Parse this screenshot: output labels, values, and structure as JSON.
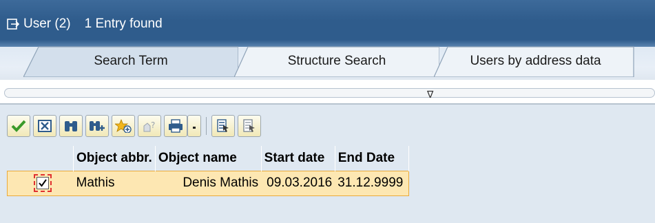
{
  "title": {
    "icon": "exit-arrow-icon",
    "object_label": "User (2)",
    "entry_count": "1 Entry found"
  },
  "tabs": [
    {
      "label": "Search Term",
      "active": true
    },
    {
      "label": "Structure Search",
      "active": false
    },
    {
      "label": "Users by address data",
      "active": false
    }
  ],
  "splitter": {
    "arrow": "∇"
  },
  "toolbar": {
    "buttons": [
      "checkmark-icon",
      "cancel-icon",
      "binoculars-icon",
      "binoculars-plus-icon",
      "star-add-icon",
      "help-hand-icon",
      "print-icon",
      "dropdown-arrow-icon",
      "select-all-icon",
      "deselect-all-icon"
    ]
  },
  "table": {
    "headers": [
      "Object abbr.",
      "Object name",
      "Start date",
      "End Date"
    ],
    "rows": [
      {
        "checked": true,
        "object_abbr": "Mathis",
        "object_name": "Denis Mathis",
        "start_date": "09.03.2016",
        "end_date": "31.12.9999"
      }
    ]
  },
  "colors": {
    "title_bar": "#2f5c8c",
    "panel_bg": "#dfe8f1",
    "row_highlight": "#fde7b2",
    "row_border": "#e9a93a"
  }
}
